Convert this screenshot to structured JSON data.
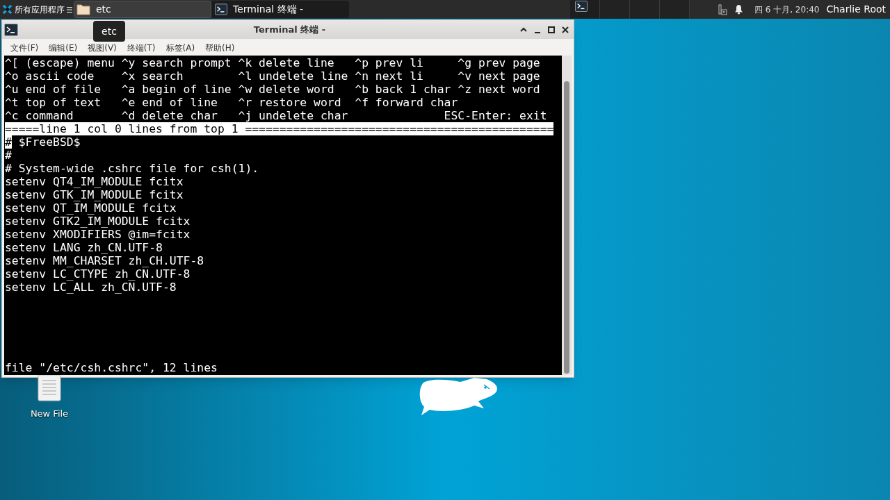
{
  "taskbar": {
    "apps_menu": {
      "label": "所有应用程序"
    },
    "tasks": [
      {
        "label": "etc",
        "kind": "folder",
        "selected": true
      },
      {
        "label": "Terminal 终端 -",
        "kind": "terminal",
        "selected": false
      }
    ],
    "workspaces": [
      {
        "selected": true
      },
      {
        "selected": false
      },
      {
        "selected": false
      },
      {
        "selected": false
      }
    ],
    "clock": "四 6 十月, 20:40",
    "user": "Charlie Root"
  },
  "tooltip": {
    "text": "etc"
  },
  "window": {
    "title": "Terminal 终端 -",
    "menu": [
      "文件(F)",
      "编辑(E)",
      "视图(V)",
      "终端(T)",
      "标签(A)",
      "帮助(H)"
    ],
    "terminal": {
      "help_lines": [
        "^[ (escape) menu ^y search prompt ^k delete line   ^p prev li     ^g prev page",
        "^o ascii code    ^x search        ^l undelete line ^n next li     ^v next page",
        "^u end of file   ^a begin of line ^w delete word   ^b back 1 char ^z next word",
        "^t top of text   ^e end of line   ^r restore word  ^f forward char",
        "^c command       ^d delete char   ^j undelete char              ESC-Enter: exit"
      ],
      "status_line": "=====line 1 col 0 lines from top 1 =============================================",
      "lines": [
        {
          "text": "# $FreeBSD$",
          "cursor": true
        },
        {
          "text": "#",
          "cursor": false
        },
        {
          "text": "# System-wide .cshrc file for csh(1).",
          "cursor": false
        },
        {
          "text": "setenv QT4_IM_MODULE fcitx",
          "cursor": false
        },
        {
          "text": "setenv GTK_IM_MODULE fcitx",
          "cursor": false
        },
        {
          "text": "setenv QT_IM_MODULE fcitx",
          "cursor": false
        },
        {
          "text": "setenv GTK2_IM_MODULE fcitx",
          "cursor": false
        },
        {
          "text": "setenv XMODIFIERS @im=fcitx",
          "cursor": false
        },
        {
          "text": "setenv LANG zh_CN.UTF-8",
          "cursor": false
        },
        {
          "text": "setenv MM_CHARSET zh_CH.UTF-8",
          "cursor": false
        },
        {
          "text": "setenv LC_CTYPE zh_CN.UTF-8",
          "cursor": false
        },
        {
          "text": "setenv LC_ALL zh_CN.UTF-8",
          "cursor": false
        }
      ],
      "message": "file \"/etc/csh.cshrc\", 12 lines"
    }
  },
  "desktop": {
    "icons": [
      {
        "label": "New File"
      }
    ]
  }
}
